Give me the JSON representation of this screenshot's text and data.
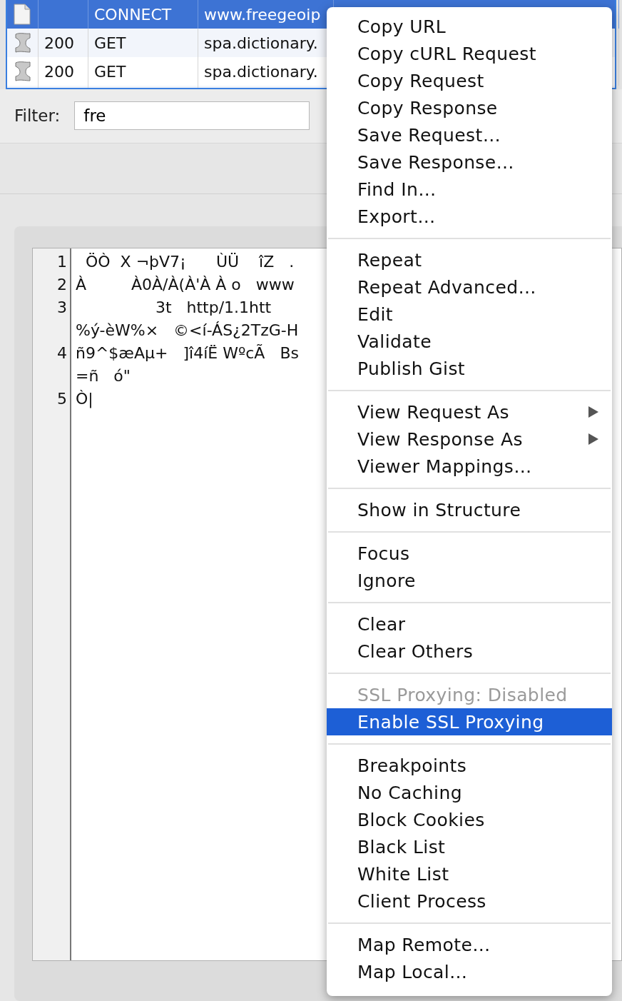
{
  "table": {
    "rows": [
      {
        "kind": "document",
        "method": "CONNECT",
        "host": "www.freegeoip",
        "selected": true
      },
      {
        "kind": "scroll",
        "status": "200",
        "method": "GET",
        "host": "spa.dictionary.",
        "selected": false
      },
      {
        "kind": "scroll",
        "status": "200",
        "method": "GET",
        "host": "spa.dictionary.",
        "selected": false
      }
    ]
  },
  "filter": {
    "label": "Filter:",
    "value": "fre"
  },
  "editor": {
    "lines": [
      {
        "number": "1",
        "text": "  ÖÒ  X ¬þV7¡      ÙÜ    îZ   ."
      },
      {
        "number": "2",
        "text": "À         À0À/À(À'À À o   www"
      },
      {
        "number": "3",
        "text": "                3t   http/1.1htt"
      },
      {
        "text": "%ý-èW%×   ©<í-ÁS¿2TzG-H"
      },
      {
        "number": "4",
        "text": "ñ9^$æAµ+   ]î4íË WºcÃ   Bs"
      },
      {
        "text": "=ñ   ó\""
      },
      {
        "number": "5",
        "text": "Ò|"
      }
    ]
  },
  "context_menu": {
    "groups": [
      {
        "items": [
          {
            "label": "Copy URL",
            "disabled": false,
            "selected": false,
            "submenu": false
          },
          {
            "label": "Copy cURL Request",
            "disabled": false,
            "selected": false,
            "submenu": false
          },
          {
            "label": "Copy Request",
            "disabled": false,
            "selected": false,
            "submenu": false
          },
          {
            "label": "Copy Response",
            "disabled": false,
            "selected": false,
            "submenu": false
          },
          {
            "label": "Save Request…",
            "disabled": false,
            "selected": false,
            "submenu": false
          },
          {
            "label": "Save Response…",
            "disabled": false,
            "selected": false,
            "submenu": false
          },
          {
            "label": "Find In…",
            "disabled": false,
            "selected": false,
            "submenu": false
          },
          {
            "label": "Export…",
            "disabled": false,
            "selected": false,
            "submenu": false
          }
        ]
      },
      {
        "items": [
          {
            "label": "Repeat",
            "disabled": false,
            "selected": false,
            "submenu": false
          },
          {
            "label": "Repeat Advanced…",
            "disabled": false,
            "selected": false,
            "submenu": false
          },
          {
            "label": "Edit",
            "disabled": false,
            "selected": false,
            "submenu": false
          },
          {
            "label": "Validate",
            "disabled": false,
            "selected": false,
            "submenu": false
          },
          {
            "label": "Publish Gist",
            "disabled": false,
            "selected": false,
            "submenu": false
          }
        ]
      },
      {
        "items": [
          {
            "label": "View Request As",
            "disabled": false,
            "selected": false,
            "submenu": true
          },
          {
            "label": "View Response As",
            "disabled": false,
            "selected": false,
            "submenu": true
          },
          {
            "label": "Viewer Mappings…",
            "disabled": false,
            "selected": false,
            "submenu": false
          }
        ]
      },
      {
        "items": [
          {
            "label": "Show in Structure",
            "disabled": false,
            "selected": false,
            "submenu": false
          }
        ]
      },
      {
        "items": [
          {
            "label": "Focus",
            "disabled": false,
            "selected": false,
            "submenu": false
          },
          {
            "label": "Ignore",
            "disabled": false,
            "selected": false,
            "submenu": false
          }
        ]
      },
      {
        "items": [
          {
            "label": "Clear",
            "disabled": false,
            "selected": false,
            "submenu": false
          },
          {
            "label": "Clear Others",
            "disabled": false,
            "selected": false,
            "submenu": false
          }
        ]
      },
      {
        "items": [
          {
            "label": "SSL Proxying: Disabled",
            "disabled": true,
            "selected": false,
            "submenu": false
          },
          {
            "label": "Enable SSL Proxying",
            "disabled": false,
            "selected": true,
            "submenu": false
          }
        ]
      },
      {
        "items": [
          {
            "label": "Breakpoints",
            "disabled": false,
            "selected": false,
            "submenu": false
          },
          {
            "label": "No Caching",
            "disabled": false,
            "selected": false,
            "submenu": false
          },
          {
            "label": "Block Cookies",
            "disabled": false,
            "selected": false,
            "submenu": false
          },
          {
            "label": "Black List",
            "disabled": false,
            "selected": false,
            "submenu": false
          },
          {
            "label": "White List",
            "disabled": false,
            "selected": false,
            "submenu": false
          },
          {
            "label": "Client Process",
            "disabled": false,
            "selected": false,
            "submenu": false
          }
        ]
      },
      {
        "items": [
          {
            "label": "Map Remote…",
            "disabled": false,
            "selected": false,
            "submenu": false
          },
          {
            "label": "Map Local…",
            "disabled": false,
            "selected": false,
            "submenu": false
          }
        ]
      }
    ]
  }
}
